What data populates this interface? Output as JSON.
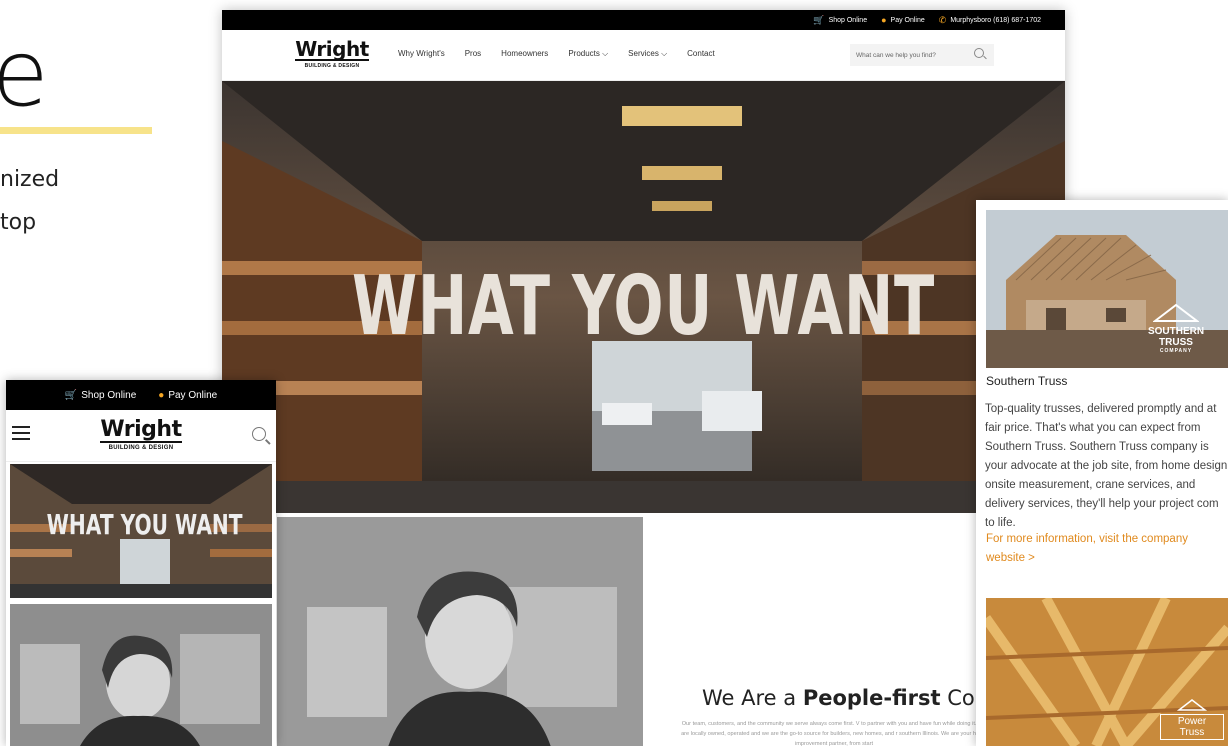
{
  "background": {
    "letter": "e",
    "line1": "nized",
    "line2": "top",
    "accent_color": "#f7e38a"
  },
  "desktop": {
    "topbar": {
      "shop": "Shop Online",
      "pay": "Pay Online",
      "phone": "Murphysboro (618) 687-1702"
    },
    "logo": {
      "word": "Wright",
      "sub": "BUILDING & DESIGN"
    },
    "nav": [
      {
        "label": "Why Wright's"
      },
      {
        "label": "Pros"
      },
      {
        "label": "Homeowners"
      },
      {
        "label": "Products ⌵"
      },
      {
        "label": "Services ⌵"
      },
      {
        "label": "Contact"
      }
    ],
    "search": {
      "placeholder": "What can we help you find?"
    },
    "hero": {
      "title": "WHAT YOU WANT"
    },
    "people": {
      "heading_pre": "We Are a ",
      "heading_bold": "People-first",
      "heading_post": " Comp",
      "body": "Our team, customers, and the community we serve always come first. V to partner with you and have fun while doing it. We are locally owned, operated and we are the go-to source for builders, new homes, and r southern Illinois. We are your home improvement partner, from start"
    }
  },
  "mobile": {
    "topbar": {
      "shop": "Shop Online",
      "pay": "Pay Online"
    },
    "logo": {
      "word": "Wright",
      "sub": "BUILDING & DESIGN"
    },
    "hero": {
      "title": "WHAT YOU WANT"
    }
  },
  "card": {
    "badge1": "SOUTHERN TRUSS",
    "badge1_sub": "COMPANY",
    "title": "Southern Truss",
    "body": "Top-quality trusses, delivered promptly and at fair price. That's what you can expect from Southern Truss. Southern Truss company is your advocate at the job site, from home design, onsite measurement, crane services, and delivery services, they'll help your project com to life.",
    "link": "For more information, visit the company website >",
    "badge2_line1": "Power",
    "badge2_line2": "Truss"
  },
  "colors": {
    "brand_orange": "#f5a623",
    "link_orange": "#e08a1e"
  }
}
